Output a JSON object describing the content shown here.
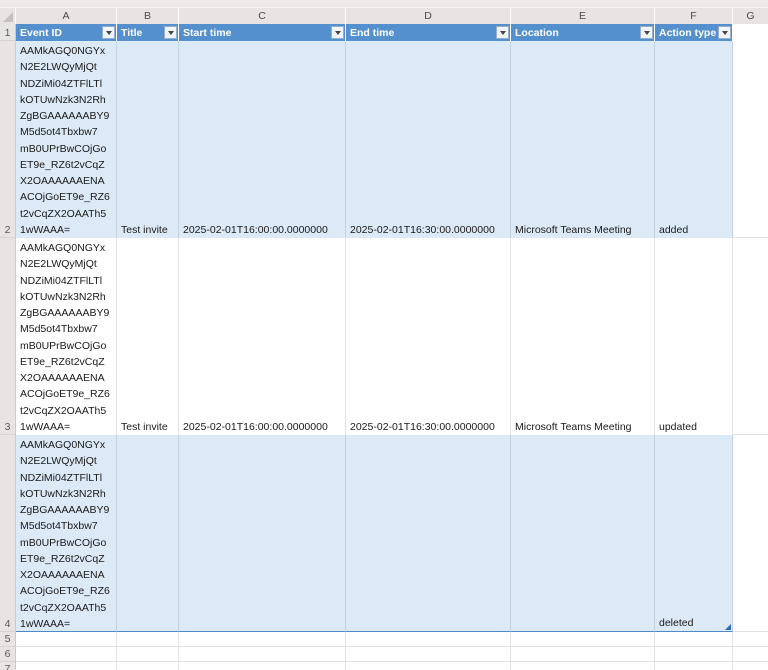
{
  "sheet": {
    "column_letters": [
      "A",
      "B",
      "C",
      "D",
      "E",
      "F",
      "G"
    ],
    "row_numbers": [
      "1",
      "2",
      "3",
      "4",
      "5",
      "6",
      "7"
    ],
    "colors": {
      "header_bg": "#5390CD",
      "band_bg": "#DCE9F6",
      "table_border": "#4E8AC8",
      "grid_line": "#E2E2E2",
      "header_text": "#FFFFFF"
    },
    "table": {
      "headers": [
        {
          "label": "Event ID"
        },
        {
          "label": "Title"
        },
        {
          "label": "Start time"
        },
        {
          "label": "End time"
        },
        {
          "label": "Location"
        },
        {
          "label": "Action type"
        }
      ],
      "rows": [
        {
          "event_id": "AAMkAGQ0NGYx\nN2E2LWQyMjQt\nNDZiMi04ZTFlLTl\nkOTUwNzk3N2Rh\nZgBGAAAAAABY9\nM5d5ot4Tbxbw7\nmB0UPrBwCOjGo\nET9e_RZ6t2vCqZ\nX2OAAAAAAENA\nACOjGoET9e_RZ6\nt2vCqZX2OAATh5\n1wWAAA=",
          "title": "Test invite",
          "start_time": "2025-02-01T16:00:00.0000000",
          "end_time": "2025-02-01T16:30:00.0000000",
          "location": "Microsoft Teams Meeting",
          "action_type": "added"
        },
        {
          "event_id": "AAMkAGQ0NGYx\nN2E2LWQyMjQt\nNDZiMi04ZTFlLTl\nkOTUwNzk3N2Rh\nZgBGAAAAAABY9\nM5d5ot4Tbxbw7\nmB0UPrBwCOjGo\nET9e_RZ6t2vCqZ\nX2OAAAAAAENA\nACOjGoET9e_RZ6\nt2vCqZX2OAATh5\n1wWAAA=",
          "title": "Test invite",
          "start_time": "2025-02-01T16:00:00.0000000",
          "end_time": "2025-02-01T16:30:00.0000000",
          "location": "Microsoft Teams Meeting",
          "action_type": "updated"
        },
        {
          "event_id": "AAMkAGQ0NGYx\nN2E2LWQyMjQt\nNDZiMi04ZTFlLTl\nkOTUwNzk3N2Rh\nZgBGAAAAAABY9\nM5d5ot4Tbxbw7\nmB0UPrBwCOjGo\nET9e_RZ6t2vCqZ\nX2OAAAAAAENA\nACOjGoET9e_RZ6\nt2vCqZX2OAATh5\n1wWAAA=",
          "title": "",
          "start_time": "",
          "end_time": "",
          "location": "",
          "action_type": "deleted"
        }
      ]
    }
  }
}
